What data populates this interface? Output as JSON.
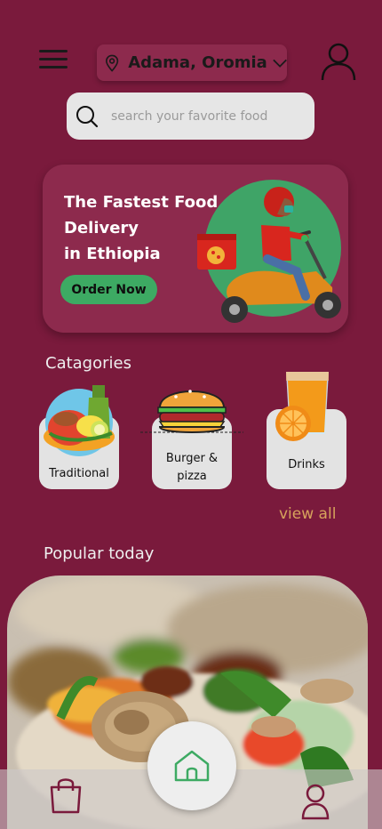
{
  "header": {
    "location": "Adama, Oromia"
  },
  "search": {
    "placeholder": "search your favorite food"
  },
  "promo": {
    "title_lines": [
      "The Fastest Food",
      "Delivery",
      "in Ethiopia"
    ],
    "cta": "Order Now"
  },
  "categories": {
    "heading": "Catagories",
    "items": [
      {
        "label": "Traditional",
        "icon": "traditional-food-icon"
      },
      {
        "label": "Burger & pizza",
        "icon": "burger-icon"
      },
      {
        "label": "Drinks",
        "icon": "orange-juice-icon"
      }
    ],
    "view_all": "view all"
  },
  "popular": {
    "heading": "Popular today"
  },
  "nav": {
    "items": [
      "shopping-bag-icon",
      "home-icon",
      "user-icon"
    ]
  },
  "colors": {
    "background": "#7a1a3c",
    "card": "#8d2a4d",
    "accent_green": "#3daa63",
    "view_all": "#d7a35c"
  }
}
